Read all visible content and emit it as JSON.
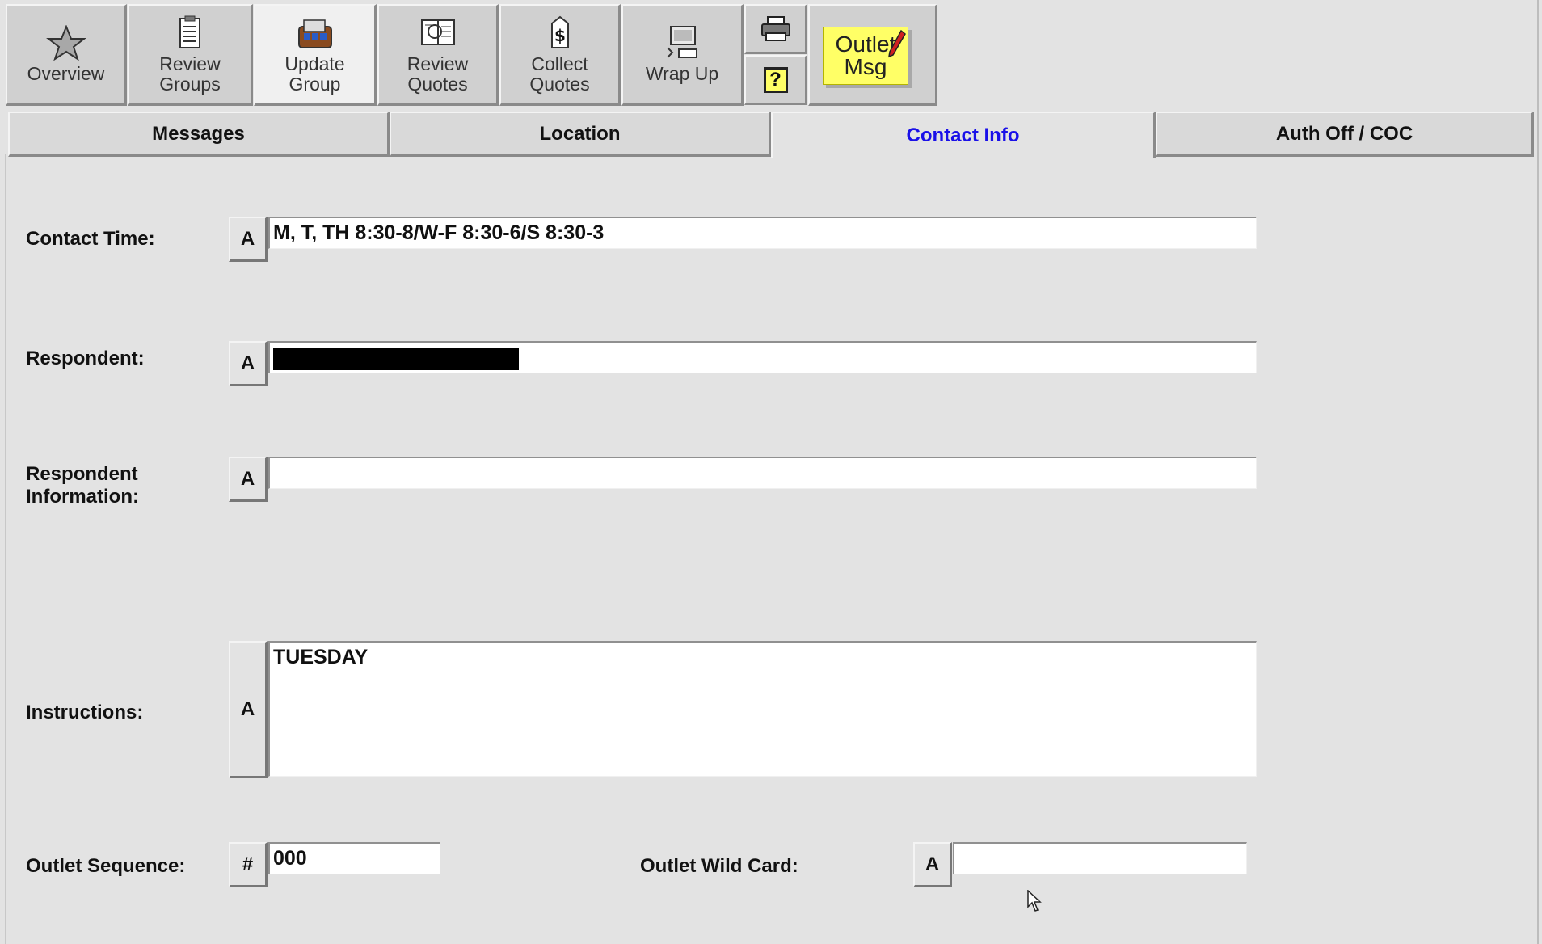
{
  "toolbar": {
    "overview": "Overview",
    "review_groups_1": "Review",
    "review_groups_2": "Groups",
    "update_group_1": "Update",
    "update_group_2": "Group",
    "review_quotes_1": "Review",
    "review_quotes_2": "Quotes",
    "collect_quotes_1": "Collect",
    "collect_quotes_2": "Quotes",
    "wrap_up": "Wrap Up",
    "help_glyph": "?",
    "outlet_msg_1": "Outlet",
    "outlet_msg_2": "Msg"
  },
  "tabs": {
    "messages": "Messages",
    "location": "Location",
    "contact_info": "Contact Info",
    "auth_off": "Auth Off / COC"
  },
  "form": {
    "contact_time_label": "Contact Time:",
    "contact_time_value": "M, T, TH 8:30-8/W-F 8:30-6/S 8:30-3",
    "respondent_label": "Respondent:",
    "respondent_info_label_1": "Respondent",
    "respondent_info_label_2": "Information:",
    "respondent_info_value": "",
    "instructions_label": "Instructions:",
    "instructions_value": "TUESDAY",
    "outlet_sequence_label": "Outlet Sequence:",
    "outlet_sequence_value": "000",
    "outlet_wild_card_label": "Outlet Wild Card:",
    "outlet_wild_card_value": "",
    "alpha_button": "A",
    "numeric_button": "#"
  },
  "colors": {
    "active_tab_text": "#1a10e8",
    "sticky_note": "#ffff66",
    "background": "#e3e3e3"
  },
  "icons": [
    "star-icon",
    "clipboard-icon",
    "update-group-icon",
    "review-quotes-icon",
    "collect-quotes-icon",
    "wrap-up-icon",
    "printer-icon",
    "help-icon",
    "pencil-icon",
    "mouse-cursor-icon"
  ]
}
